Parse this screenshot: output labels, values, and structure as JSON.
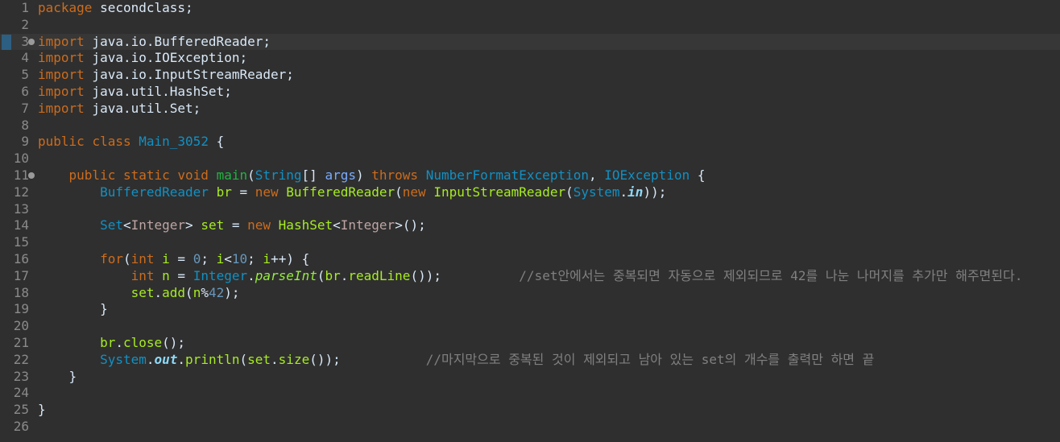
{
  "editor": {
    "colors": {
      "background": "#2f2f2f",
      "current_line": "#373737",
      "line_number": "#8a8a8a",
      "bookmark": "#2d5f82"
    },
    "lines": [
      {
        "num": "1",
        "tokens": [
          {
            "t": "package",
            "k": "keyword"
          },
          {
            "t": " secondclass;",
            "k": "text"
          }
        ]
      },
      {
        "num": "2",
        "tokens": []
      },
      {
        "num": "3",
        "current": true,
        "bookmark": true,
        "marker": "collapse-marker-icon",
        "tokens": [
          {
            "t": "import",
            "k": "keyword"
          },
          {
            "t": " java.io.BufferedReader;",
            "k": "text"
          }
        ]
      },
      {
        "num": "4",
        "tokens": [
          {
            "t": "import",
            "k": "keyword"
          },
          {
            "t": " java.io.IOException;",
            "k": "text"
          }
        ]
      },
      {
        "num": "5",
        "tokens": [
          {
            "t": "import",
            "k": "keyword"
          },
          {
            "t": " java.io.InputStreamReader;",
            "k": "text"
          }
        ]
      },
      {
        "num": "6",
        "tokens": [
          {
            "t": "import",
            "k": "keyword"
          },
          {
            "t": " java.util.HashSet;",
            "k": "text"
          }
        ]
      },
      {
        "num": "7",
        "tokens": [
          {
            "t": "import",
            "k": "keyword"
          },
          {
            "t": " java.util.Set;",
            "k": "text"
          }
        ]
      },
      {
        "num": "8",
        "tokens": []
      },
      {
        "num": "9",
        "tokens": [
          {
            "t": "public",
            "k": "keyword"
          },
          {
            "t": " ",
            "k": "text"
          },
          {
            "t": "class",
            "k": "keyword"
          },
          {
            "t": " ",
            "k": "text"
          },
          {
            "t": "Main_3052",
            "k": "type"
          },
          {
            "t": " {",
            "k": "text"
          }
        ]
      },
      {
        "num": "10",
        "tokens": []
      },
      {
        "num": "11",
        "marker": "collapse-marker-icon",
        "tokens": [
          {
            "t": "    ",
            "k": "text"
          },
          {
            "t": "public",
            "k": "keyword"
          },
          {
            "t": " ",
            "k": "text"
          },
          {
            "t": "static",
            "k": "keyword"
          },
          {
            "t": " ",
            "k": "text"
          },
          {
            "t": "void",
            "k": "keyword"
          },
          {
            "t": " ",
            "k": "text"
          },
          {
            "t": "main",
            "k": "class"
          },
          {
            "t": "(",
            "k": "text"
          },
          {
            "t": "String",
            "k": "type"
          },
          {
            "t": "[] ",
            "k": "text"
          },
          {
            "t": "args",
            "k": "param"
          },
          {
            "t": ") ",
            "k": "text"
          },
          {
            "t": "throws",
            "k": "keyword"
          },
          {
            "t": " ",
            "k": "text"
          },
          {
            "t": "NumberFormatException",
            "k": "type"
          },
          {
            "t": ", ",
            "k": "text"
          },
          {
            "t": "IOException",
            "k": "type"
          },
          {
            "t": " {",
            "k": "text"
          }
        ]
      },
      {
        "num": "12",
        "tokens": [
          {
            "t": "        ",
            "k": "text"
          },
          {
            "t": "BufferedReader",
            "k": "type"
          },
          {
            "t": " ",
            "k": "text"
          },
          {
            "t": "br",
            "k": "method"
          },
          {
            "t": " = ",
            "k": "text"
          },
          {
            "t": "new",
            "k": "keyword"
          },
          {
            "t": " ",
            "k": "text"
          },
          {
            "t": "BufferedReader",
            "k": "method"
          },
          {
            "t": "(",
            "k": "text"
          },
          {
            "t": "new",
            "k": "keyword"
          },
          {
            "t": " ",
            "k": "text"
          },
          {
            "t": "InputStreamReader",
            "k": "method"
          },
          {
            "t": "(",
            "k": "text"
          },
          {
            "t": "System",
            "k": "type"
          },
          {
            "t": ".",
            "k": "text"
          },
          {
            "t": "in",
            "k": "static-field"
          },
          {
            "t": "));",
            "k": "text"
          }
        ]
      },
      {
        "num": "13",
        "tokens": []
      },
      {
        "num": "14",
        "tokens": [
          {
            "t": "        ",
            "k": "text"
          },
          {
            "t": "Set",
            "k": "type"
          },
          {
            "t": "<",
            "k": "text"
          },
          {
            "t": "Integer",
            "k": "generic"
          },
          {
            "t": "> ",
            "k": "text"
          },
          {
            "t": "set",
            "k": "method"
          },
          {
            "t": " = ",
            "k": "text"
          },
          {
            "t": "new",
            "k": "keyword"
          },
          {
            "t": " ",
            "k": "text"
          },
          {
            "t": "HashSet",
            "k": "method"
          },
          {
            "t": "<",
            "k": "text"
          },
          {
            "t": "Integer",
            "k": "generic"
          },
          {
            "t": ">();",
            "k": "text"
          }
        ]
      },
      {
        "num": "15",
        "tokens": []
      },
      {
        "num": "16",
        "tokens": [
          {
            "t": "        ",
            "k": "text"
          },
          {
            "t": "for",
            "k": "keyword"
          },
          {
            "t": "(",
            "k": "text"
          },
          {
            "t": "int",
            "k": "keyword"
          },
          {
            "t": " ",
            "k": "text"
          },
          {
            "t": "i",
            "k": "method"
          },
          {
            "t": " = ",
            "k": "text"
          },
          {
            "t": "0",
            "k": "number"
          },
          {
            "t": "; ",
            "k": "text"
          },
          {
            "t": "i",
            "k": "method"
          },
          {
            "t": "<",
            "k": "text"
          },
          {
            "t": "10",
            "k": "number"
          },
          {
            "t": "; ",
            "k": "text"
          },
          {
            "t": "i",
            "k": "method"
          },
          {
            "t": "++) {",
            "k": "text"
          }
        ]
      },
      {
        "num": "17",
        "tokens": [
          {
            "t": "            ",
            "k": "text"
          },
          {
            "t": "int",
            "k": "keyword"
          },
          {
            "t": " ",
            "k": "text"
          },
          {
            "t": "n",
            "k": "method"
          },
          {
            "t": " = ",
            "k": "text"
          },
          {
            "t": "Integer",
            "k": "type"
          },
          {
            "t": ".",
            "k": "text"
          },
          {
            "t": "parseInt",
            "k": "static-method"
          },
          {
            "t": "(",
            "k": "text"
          },
          {
            "t": "br",
            "k": "method"
          },
          {
            "t": ".",
            "k": "text"
          },
          {
            "t": "readLine",
            "k": "method"
          },
          {
            "t": "());          ",
            "k": "text"
          },
          {
            "t": "//set안에서는 중복되면 자동으로 제외되므로 42를 나눈 나머지를 추가만 해주면된다.",
            "k": "comment"
          }
        ]
      },
      {
        "num": "18",
        "tokens": [
          {
            "t": "            ",
            "k": "text"
          },
          {
            "t": "set",
            "k": "method"
          },
          {
            "t": ".",
            "k": "text"
          },
          {
            "t": "add",
            "k": "method"
          },
          {
            "t": "(",
            "k": "text"
          },
          {
            "t": "n",
            "k": "method"
          },
          {
            "t": "%",
            "k": "text"
          },
          {
            "t": "42",
            "k": "number"
          },
          {
            "t": ");",
            "k": "text"
          }
        ]
      },
      {
        "num": "19",
        "tokens": [
          {
            "t": "        }",
            "k": "text"
          }
        ]
      },
      {
        "num": "20",
        "tokens": []
      },
      {
        "num": "21",
        "tokens": [
          {
            "t": "        ",
            "k": "text"
          },
          {
            "t": "br",
            "k": "method"
          },
          {
            "t": ".",
            "k": "text"
          },
          {
            "t": "close",
            "k": "method"
          },
          {
            "t": "();",
            "k": "text"
          }
        ]
      },
      {
        "num": "22",
        "tokens": [
          {
            "t": "        ",
            "k": "text"
          },
          {
            "t": "System",
            "k": "type"
          },
          {
            "t": ".",
            "k": "text"
          },
          {
            "t": "out",
            "k": "static-field"
          },
          {
            "t": ".",
            "k": "text"
          },
          {
            "t": "println",
            "k": "method"
          },
          {
            "t": "(",
            "k": "text"
          },
          {
            "t": "set",
            "k": "method"
          },
          {
            "t": ".",
            "k": "text"
          },
          {
            "t": "size",
            "k": "method"
          },
          {
            "t": "());           ",
            "k": "text"
          },
          {
            "t": "//마지막으로 중복된 것이 제외되고 남아 있는 set의 개수를 출력만 하면 끝",
            "k": "comment"
          }
        ]
      },
      {
        "num": "23",
        "tokens": [
          {
            "t": "    }",
            "k": "text"
          }
        ]
      },
      {
        "num": "24",
        "tokens": []
      },
      {
        "num": "25",
        "tokens": [
          {
            "t": "}",
            "k": "text"
          }
        ]
      },
      {
        "num": "26",
        "tokens": []
      }
    ]
  }
}
